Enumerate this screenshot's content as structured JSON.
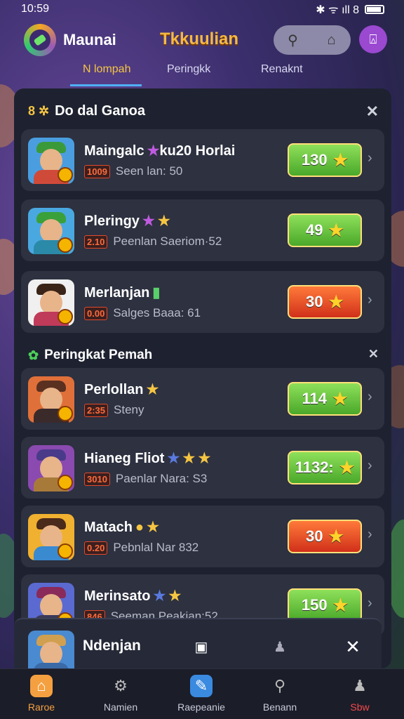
{
  "status_bar": {
    "time": "10:59",
    "status_icons": "✱ ᯤ ıll 8"
  },
  "header": {
    "app_name": "Maunai",
    "page_title": "Tkkuulian",
    "search_icon": "search-icon",
    "home_icon": "home-icon",
    "profile_icon": "profile-icon"
  },
  "tabs": [
    {
      "label": "N lompah",
      "active": true
    },
    {
      "label": "Peringkk",
      "active": false
    },
    {
      "label": "Renaknt",
      "active": false
    }
  ],
  "section1": {
    "title": "Do dal Ganoa",
    "close": "✕"
  },
  "section2": {
    "title": "Peringkat Pemah",
    "close": "✕"
  },
  "rows": [
    {
      "name": "Maingalc",
      "name2": "ku20 Horlai",
      "stars": [
        "★"
      ],
      "rank": "1009",
      "sub": "Seen lan: 50",
      "score": "130",
      "score_color": "green",
      "colors": {
        "bg": "#4a9ee0",
        "hat": "#3a9a3a",
        "body": "#d04a3a"
      }
    },
    {
      "name": "Pleringy",
      "name2": "",
      "stars": [
        "★",
        "★"
      ],
      "rank": "2.10",
      "sub": "Peenlan Saeriom·52",
      "score": "49",
      "score_color": "green",
      "colors": {
        "bg": "#4aa8e0",
        "hat": "#3aa03a",
        "body": "#2a8aa8"
      }
    },
    {
      "name": "Merlanjan",
      "name2": "",
      "stars": [
        "▮"
      ],
      "rank": "0.00",
      "sub": "Salges Baaa: 61",
      "score": "30",
      "score_color": "red",
      "colors": {
        "bg": "#f0f0f0",
        "hat": "#3a2418",
        "body": "#c03a5a"
      }
    },
    {
      "name": "Perlollan",
      "name2": "",
      "stars": [
        "★"
      ],
      "rank": "2:35",
      "sub": "Steny",
      "score": "114",
      "score_color": "green",
      "colors": {
        "bg": "#e0703a",
        "hat": "#5a3020",
        "body": "#3a2a2a"
      }
    },
    {
      "name": "Hianeg Fliot",
      "name2": "",
      "stars": [
        "★",
        "★",
        "★"
      ],
      "rank": "3010",
      "sub": "Paenlar Nara: S3",
      "score": "1132:",
      "score_color": "green",
      "colors": {
        "bg": "#8a4ab0",
        "hat": "#4a3a8a",
        "body": "#a87a3a"
      }
    },
    {
      "name": "Matach",
      "name2": "",
      "stars": [
        "●",
        "★"
      ],
      "rank": "0.20",
      "sub": "Pebnlal Nar 832",
      "score": "30",
      "score_color": "red",
      "colors": {
        "bg": "#f0b030",
        "hat": "#4a2a1a",
        "body": "#3a8ad0"
      }
    },
    {
      "name": "Merinsato",
      "name2": "",
      "stars": [
        "★",
        "★"
      ],
      "rank": "846",
      "sub": "Seeman Peakian:52",
      "score": "150",
      "score_color": "green",
      "colors": {
        "bg": "#5a6ad0",
        "hat": "#8a2a5a",
        "body": "#3a3a5a"
      }
    }
  ],
  "sticky_user": {
    "name": "Ndenjan",
    "badge_icon": "badge-icon",
    "user_icon": "user-icon",
    "close": "✕"
  },
  "bottom_nav": [
    {
      "label": "Raroe",
      "icon": "home-icon",
      "active": true
    },
    {
      "label": "Namien",
      "icon": "gear-icon",
      "active": false
    },
    {
      "label": "Raepeanie",
      "icon": "edit-icon",
      "active": false
    },
    {
      "label": "Benann",
      "icon": "search-icon",
      "active": false
    },
    {
      "label": "Sbw",
      "icon": "user-icon",
      "active": false
    }
  ]
}
